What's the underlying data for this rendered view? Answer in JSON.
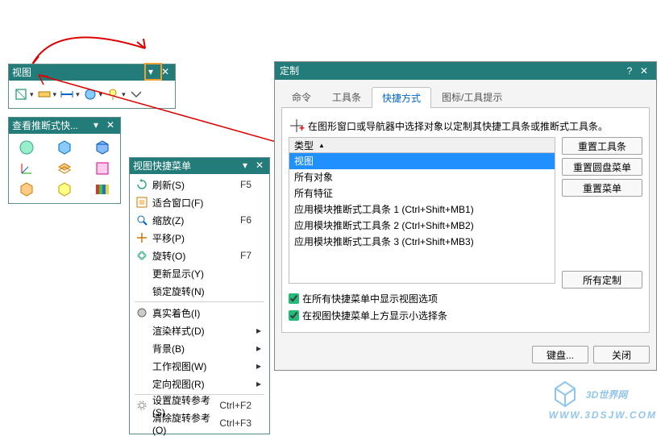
{
  "view_panel": {
    "title": "视图"
  },
  "inferred_panel": {
    "title": "查看推断式快..."
  },
  "context_menu": {
    "title": "视图快捷菜单",
    "items": [
      {
        "icon": "refresh",
        "label": "刷新(S)",
        "shortcut": "F5",
        "type": "item"
      },
      {
        "icon": "fit",
        "label": "适合窗口(F)",
        "type": "item"
      },
      {
        "icon": "zoom",
        "label": "缩放(Z)",
        "shortcut": "F6",
        "type": "item"
      },
      {
        "icon": "pan",
        "label": "平移(P)",
        "type": "item"
      },
      {
        "icon": "rotate",
        "label": "旋转(O)",
        "shortcut": "F7",
        "type": "item"
      },
      {
        "label": "更新显示(Y)",
        "type": "item"
      },
      {
        "label": "锁定旋转(N)",
        "type": "item"
      },
      {
        "type": "sep"
      },
      {
        "icon": "shade",
        "label": "真实着色(I)",
        "type": "item"
      },
      {
        "label": "渲染样式(D)",
        "type": "sub"
      },
      {
        "label": "背景(B)",
        "type": "sub"
      },
      {
        "label": "工作视图(W)",
        "type": "sub"
      },
      {
        "label": "定向视图(R)",
        "type": "sub"
      },
      {
        "type": "sep"
      },
      {
        "icon": "gear",
        "label": "设置旋转参考(S)",
        "shortcut": "Ctrl+F2",
        "type": "item"
      },
      {
        "label": "清除旋转参考(O)",
        "shortcut": "Ctrl+F3",
        "type": "item"
      }
    ]
  },
  "customize_dlg": {
    "title": "定制",
    "tabs": [
      "命令",
      "工具条",
      "快捷方式",
      "图标/工具提示"
    ],
    "active_tab": 2,
    "hint": "在图形窗口或导航器中选择对象以定制其快捷工具条或推断式工具条。",
    "col_header": "类型",
    "list": [
      "视图",
      "所有对象",
      "所有特征",
      "应用模块推断式工具条 1 (Ctrl+Shift+MB1)",
      "应用模块推断式工具条 2 (Ctrl+Shift+MB2)",
      "应用模块推断式工具条 3 (Ctrl+Shift+MB3)"
    ],
    "selected": 0,
    "buttons": {
      "reset_tb": "重置工具条",
      "reset_radial": "重置圆盘菜单",
      "reset_menu": "重置菜单",
      "all_custom": "所有定制"
    },
    "chk1": "在所有快捷菜单中显示视图选项",
    "chk2": "在视图快捷菜单上方显示小选择条",
    "keyboard": "键盘...",
    "close": "关闭"
  },
  "watermark": {
    "name": "3D世界网",
    "url": "WWW.3DSJW.COM"
  }
}
